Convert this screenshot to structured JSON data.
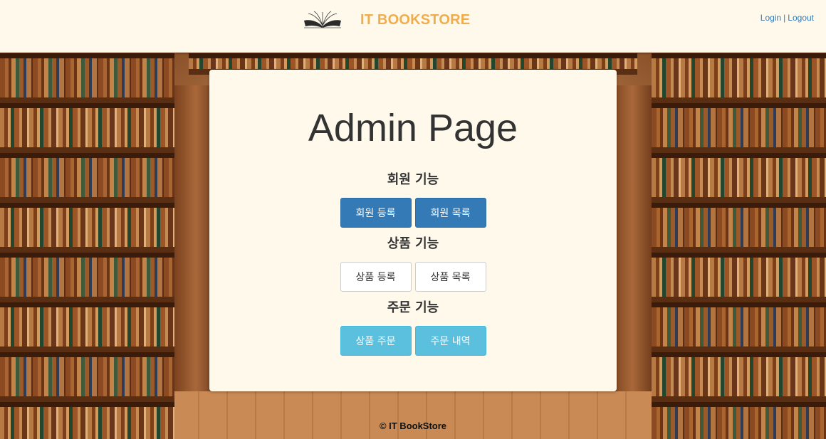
{
  "header": {
    "brand_title": "IT BOOKSTORE",
    "logo_icon": "open-book-icon",
    "login_label": "Login",
    "separator": "|",
    "logout_label": "Logout"
  },
  "main": {
    "title": "Admin Page",
    "sections": [
      {
        "title": "회원 기능",
        "buttons": [
          {
            "label": "회원 등록",
            "style": "primary"
          },
          {
            "label": "회원 목록",
            "style": "primary"
          }
        ]
      },
      {
        "title": "상품 기능",
        "buttons": [
          {
            "label": "상품 등록",
            "style": "default"
          },
          {
            "label": "상품 목록",
            "style": "default"
          }
        ]
      },
      {
        "title": "주문 기능",
        "buttons": [
          {
            "label": "상품 주문",
            "style": "info"
          },
          {
            "label": "주문 내역",
            "style": "info"
          }
        ]
      }
    ]
  },
  "footer": {
    "copyright": "© IT BookStore"
  },
  "colors": {
    "brand": "#f0ad4e",
    "link": "#337ab7",
    "primary": "#337ab7",
    "info": "#5bc0de",
    "panel_bg": "#fff9ec"
  }
}
